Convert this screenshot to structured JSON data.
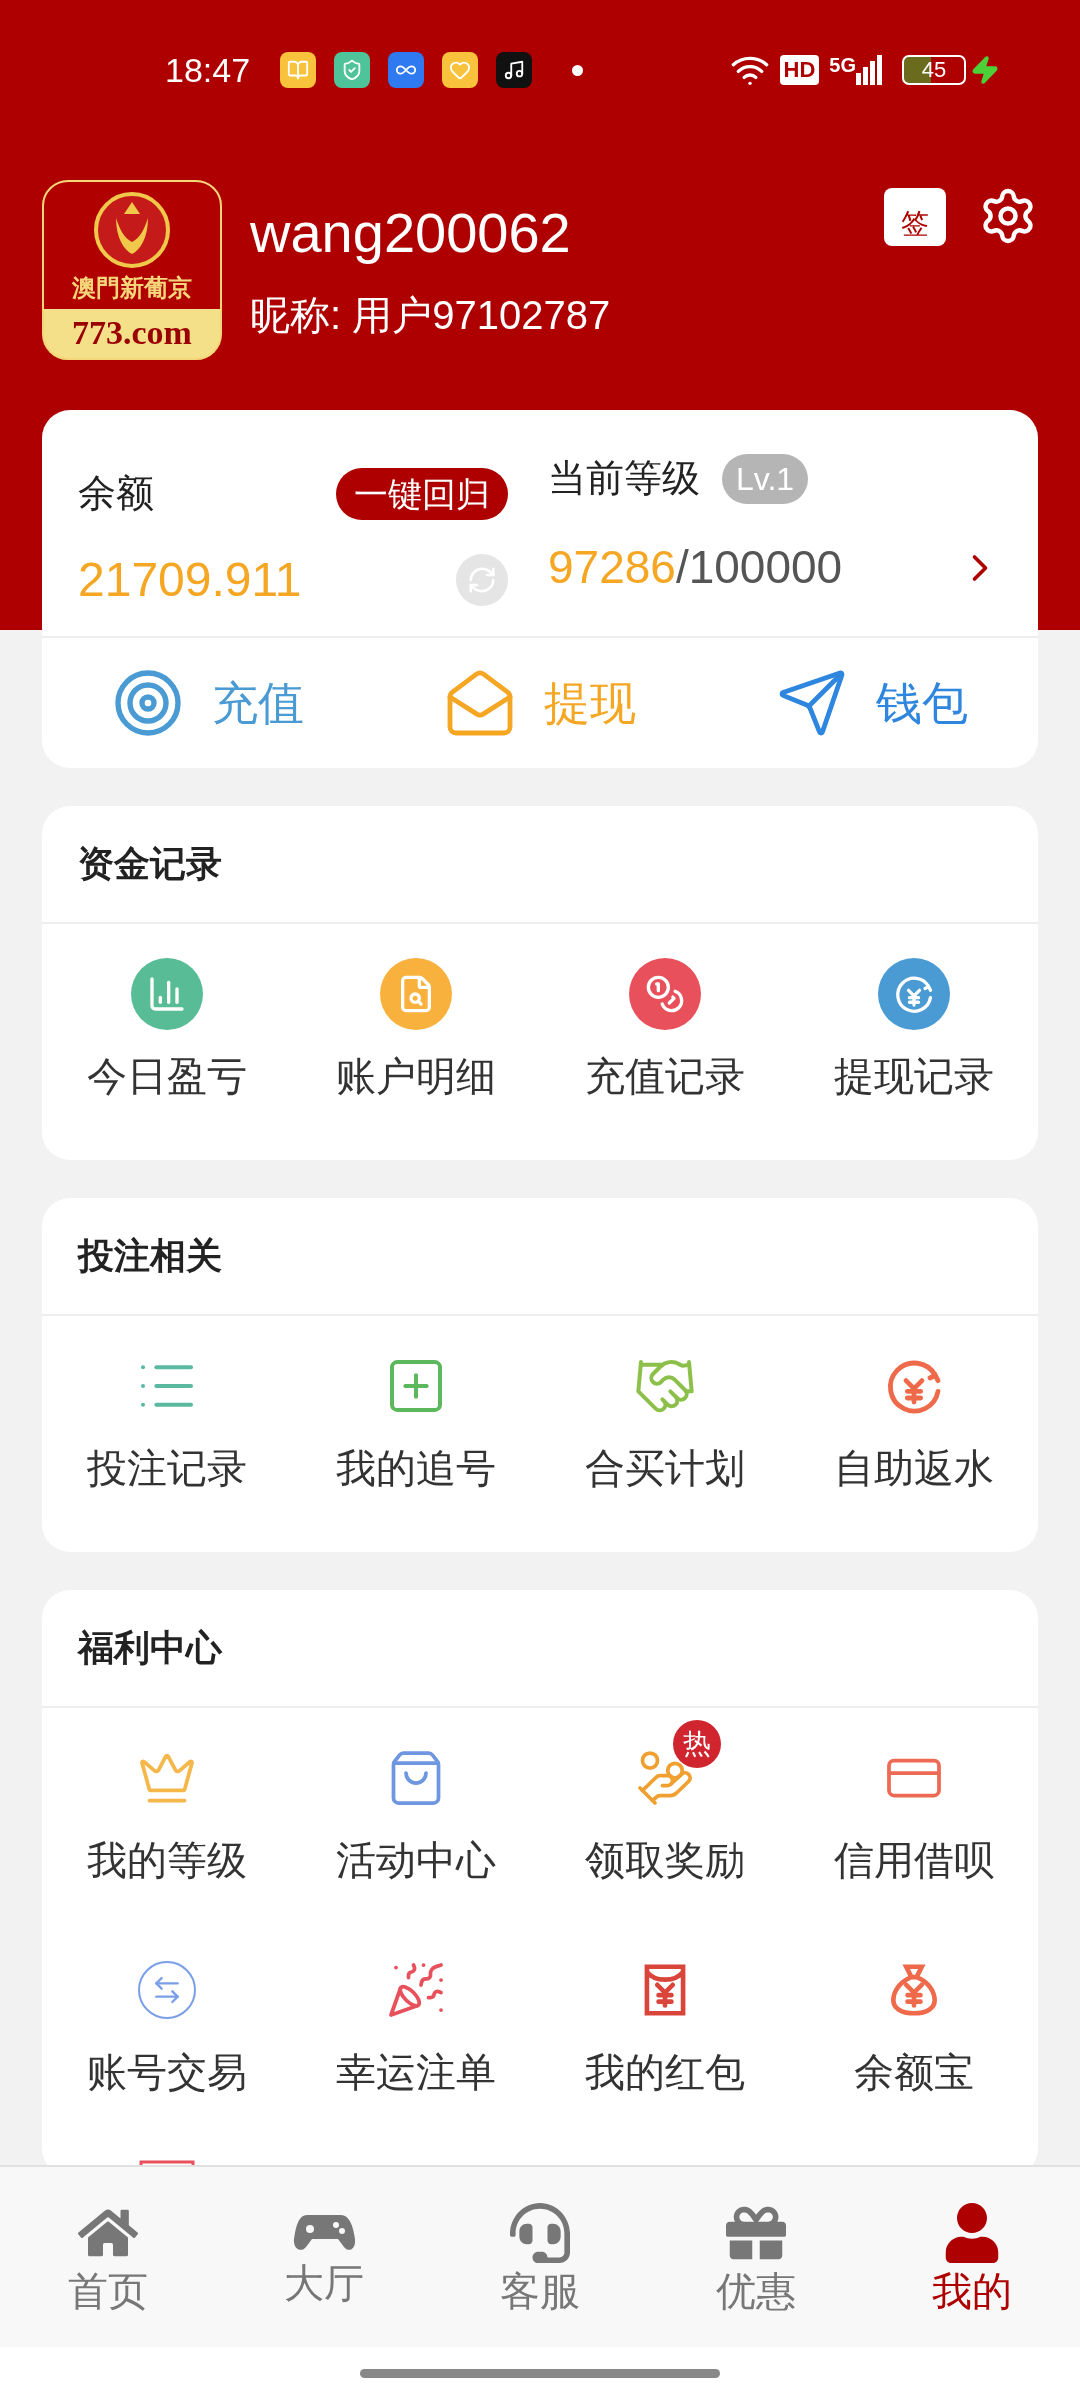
{
  "status_bar": {
    "time": "18:47",
    "hd": "HD",
    "network": "5G",
    "battery": "45"
  },
  "profile": {
    "logo_top": "澳門新葡京",
    "logo_bottom": "773.com",
    "username": "wang200062",
    "nickname": "昵称: 用户97102787",
    "sign_in": "签"
  },
  "balance_card": {
    "balance_label": "余额",
    "recall_button": "一键回归",
    "balance": "21709.911",
    "level_label": "当前等级",
    "level_badge": "Lv.1",
    "points": "97286",
    "points_total": "/100000",
    "actions": [
      {
        "kind": "recharge",
        "label": "充值"
      },
      {
        "kind": "withdraw",
        "label": "提现"
      },
      {
        "kind": "wallet",
        "label": "钱包"
      }
    ]
  },
  "sections": [
    {
      "title": "资金记录",
      "items": [
        {
          "kind": "profit",
          "label": "今日盈亏"
        },
        {
          "kind": "details",
          "label": "账户明细"
        },
        {
          "kind": "deposits",
          "label": "充值记录"
        },
        {
          "kind": "withdrawals",
          "label": "提现记录"
        }
      ]
    },
    {
      "title": "投注相关",
      "items": [
        {
          "kind": "bets",
          "label": "投注记录"
        },
        {
          "kind": "chase",
          "label": "我的追号"
        },
        {
          "kind": "group",
          "label": "合买计划"
        },
        {
          "kind": "rebate",
          "label": "自助返水"
        }
      ]
    },
    {
      "title": "福利中心",
      "items": [
        {
          "kind": "level",
          "label": "我的等级"
        },
        {
          "kind": "events",
          "label": "活动中心"
        },
        {
          "kind": "reward",
          "label": "领取奖励",
          "badge": "热"
        },
        {
          "kind": "credit",
          "label": "信用借呗"
        },
        {
          "kind": "trade",
          "label": "账号交易"
        },
        {
          "kind": "lucky",
          "label": "幸运注单"
        },
        {
          "kind": "redpacket",
          "label": "我的红包"
        },
        {
          "kind": "savings",
          "label": "余额宝"
        }
      ]
    }
  ],
  "bottom_nav": [
    {
      "kind": "home",
      "label": "首页",
      "selected": false
    },
    {
      "kind": "lobby",
      "label": "大厅",
      "selected": false
    },
    {
      "kind": "service",
      "label": "客服",
      "selected": false
    },
    {
      "kind": "offers",
      "label": "优惠",
      "selected": false
    },
    {
      "kind": "mine",
      "label": "我的",
      "selected": true
    }
  ]
}
